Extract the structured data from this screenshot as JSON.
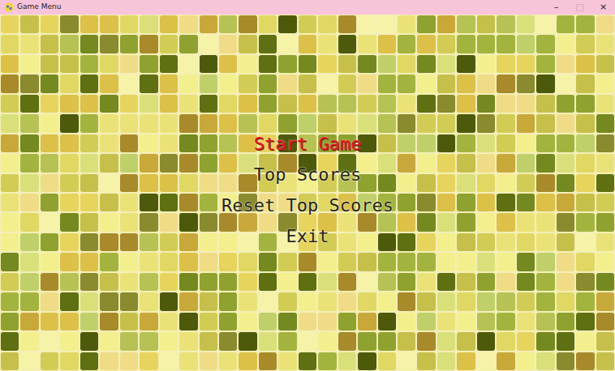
{
  "window": {
    "title": "Game Menu",
    "controls": [
      {
        "glyph": "–",
        "disabled": false
      },
      {
        "glyph": "□",
        "disabled": true
      },
      {
        "glyph": "×",
        "disabled": false
      }
    ]
  },
  "menu": {
    "items": [
      {
        "label": "Start Game",
        "selected": true
      },
      {
        "label": "Top Scores",
        "selected": false
      },
      {
        "label": "Reset Top Scores",
        "selected": false
      },
      {
        "label": "Exit",
        "selected": false
      }
    ]
  }
}
